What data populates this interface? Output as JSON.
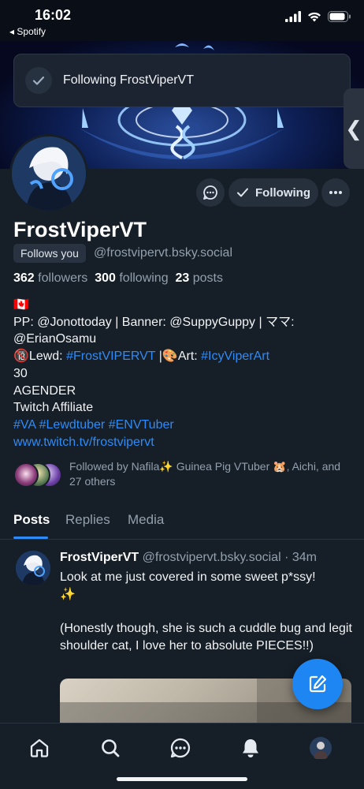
{
  "status_bar": {
    "time": "16:02",
    "back_app": "◂ Spotify"
  },
  "toast": {
    "message": "Following FrostViperVT"
  },
  "profile": {
    "display_name": "FrostViperVT",
    "follows_you_badge": "Follows you",
    "handle": "@frostvipervt.bsky.social",
    "followers_count": "362",
    "followers_label": "followers",
    "following_count": "300",
    "following_label": "following",
    "posts_count": "23",
    "posts_label": "posts",
    "following_button": "Following",
    "bio": {
      "flag": "🇨🇦",
      "line1": "PP: @Jonottoday | Banner: @SuppyGuppy | ママ: @ErianOsamu",
      "lewd_prefix": "🔞Lewd: ",
      "lewd_tag": "#FrostVIPERVT",
      "art_prefix": " |🎨Art: ",
      "art_tag": "#IcyViperArt",
      "age": "30",
      "gender": "AGENDER",
      "affiliate": "Twitch Affiliate",
      "tag_va": "#VA",
      "tag_lewdtuber": "#Lewdtuber",
      "tag_envtuber": "#ENVTuber",
      "website": "www.twitch.tv/frostvipervt"
    },
    "followed_by": "Followed by Nafila✨ Guinea Pig VTuber 🐹, Aichi, and 27 others"
  },
  "tabs": [
    {
      "label": "Posts",
      "active": true
    },
    {
      "label": "Replies",
      "active": false
    },
    {
      "label": "Media",
      "active": false
    }
  ],
  "post": {
    "author": "FrostViperVT",
    "handle": "@frostvipervt.bsky.social",
    "time": "· 34m",
    "line1": "Look at me just covered in some sweet p*ssy!",
    "line2": "✨",
    "line3": "(Honestly though, she is such a cuddle bug and legit shoulder cat, I love her to absolute PIECES!!)"
  },
  "colors": {
    "background": "#161e27",
    "accent": "#2f8bf5",
    "muted_text": "#93a0ae"
  },
  "icons": {
    "nav": [
      "home-icon",
      "search-icon",
      "chat-icon",
      "bell-icon",
      "profile-avatar"
    ],
    "fab": "compose-icon",
    "actions": [
      "message-icon",
      "checkmark-icon",
      "more-icon"
    ]
  }
}
